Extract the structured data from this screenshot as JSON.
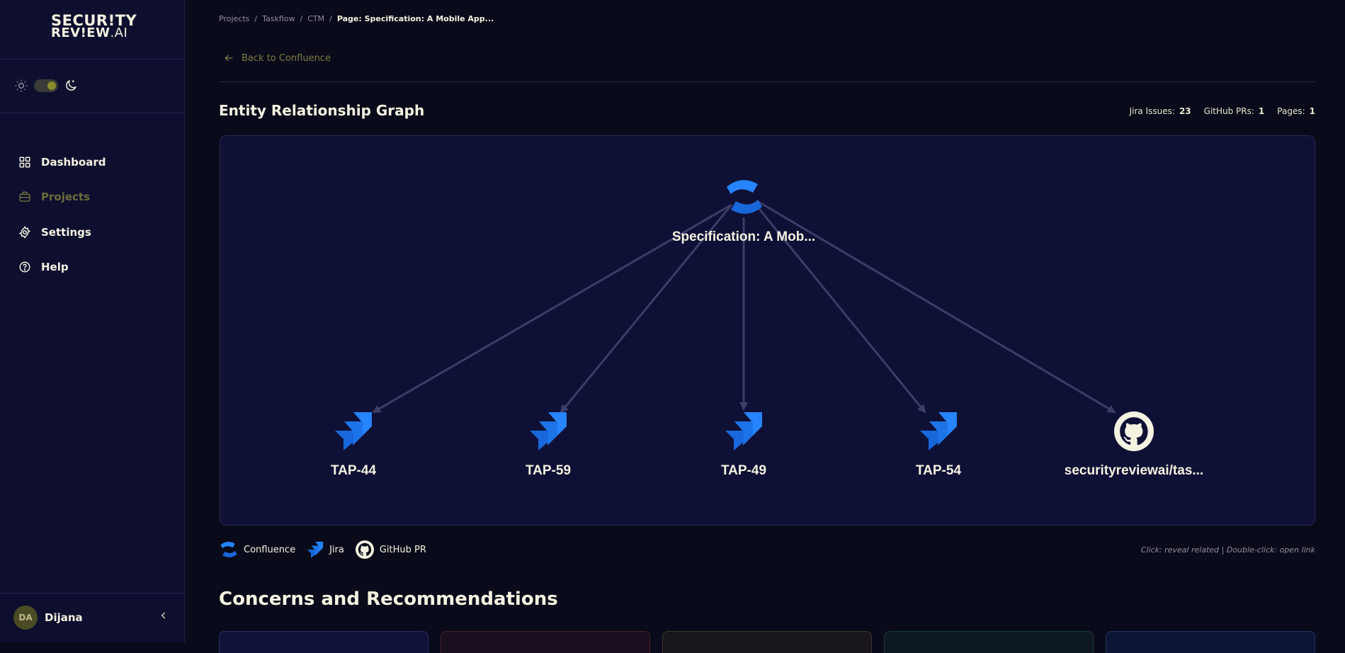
{
  "brand": {
    "line1": "SECUR!TY",
    "line2": "REV!EW",
    "suffix": ".AI"
  },
  "sidebar": {
    "items": [
      {
        "label": "Dashboard",
        "icon": "grid-icon"
      },
      {
        "label": "Projects",
        "icon": "briefcase-icon"
      },
      {
        "label": "Settings",
        "icon": "gear-icon"
      },
      {
        "label": "Help",
        "icon": "help-circle-icon"
      }
    ]
  },
  "user": {
    "initials": "DA",
    "name": "Dijana"
  },
  "breadcrumb": [
    "Projects",
    "Taskflow",
    "CTM",
    "Page: Specification: A Mobile App..."
  ],
  "back_label": "Back to Confluence",
  "graph": {
    "title": "Entity Relationship Graph",
    "stats": [
      {
        "label": "Jira Issues:",
        "value": "23"
      },
      {
        "label": "GitHub PRs:",
        "value": "1"
      },
      {
        "label": "Pages:",
        "value": "1"
      }
    ],
    "root": {
      "label": "Specification: A Mob...",
      "type": "confluence"
    },
    "children": [
      {
        "label": "TAP-44",
        "type": "jira"
      },
      {
        "label": "TAP-59",
        "type": "jira"
      },
      {
        "label": "TAP-49",
        "type": "jira"
      },
      {
        "label": "TAP-54",
        "type": "jira"
      },
      {
        "label": "securityreviewai/tas...",
        "type": "github"
      }
    ]
  },
  "legend": [
    {
      "label": "Confluence",
      "icon": "confluence-icon"
    },
    {
      "label": "Jira",
      "icon": "jira-icon"
    },
    {
      "label": "GitHub PR",
      "icon": "github-icon"
    }
  ],
  "hint": "Click: reveal related | Double-click: open link",
  "concerns_title": "Concerns and Recommendations",
  "colors": {
    "accent": "#7c7b44",
    "jira": "#2684ff",
    "confluence": "#2684ff",
    "edge": "#3b3e68"
  }
}
